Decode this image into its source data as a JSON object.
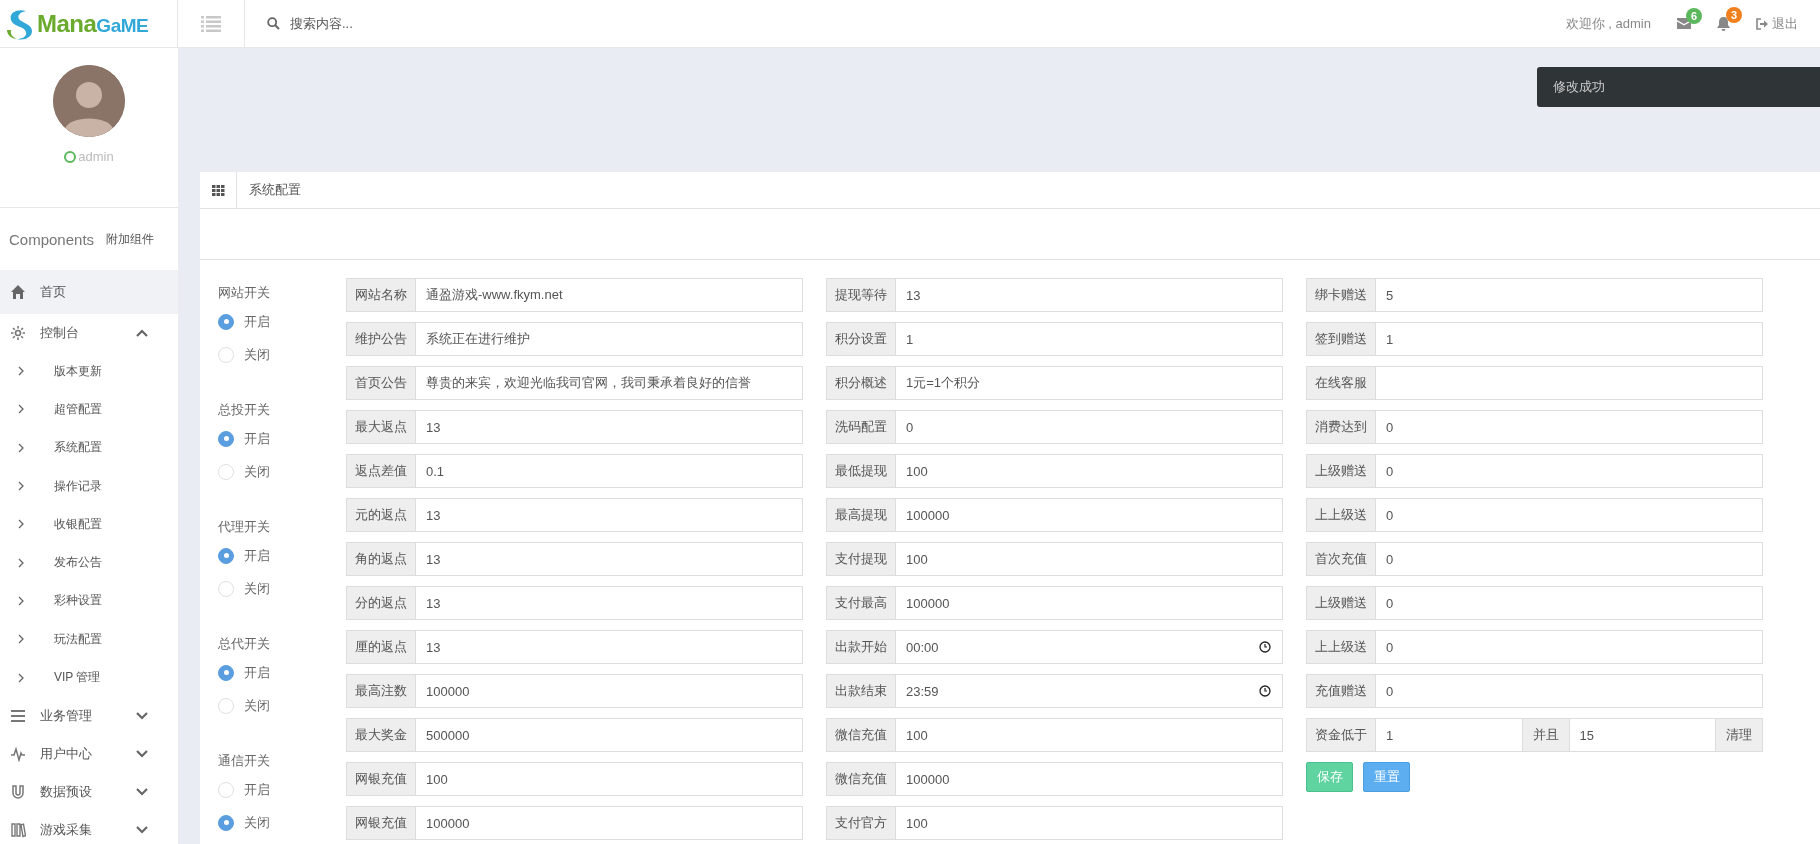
{
  "header": {
    "logo": {
      "first": "Mana",
      "second": "GaME"
    },
    "search": {
      "placeholder": "搜索内容..."
    },
    "welcome": "欢迎你 , admin",
    "messages_badge": "6",
    "alerts_badge": "3",
    "logout": "退出"
  },
  "toast": {
    "message": "修改成功"
  },
  "sidebar": {
    "user": {
      "name": "admin",
      "online": true
    },
    "components": {
      "title": "Components",
      "subtitle": "附加组件"
    },
    "menu": [
      {
        "label": "首页",
        "selected": true
      },
      {
        "label": "控制台",
        "selected": false,
        "expanded": true,
        "children": [
          {
            "label": "版本更新",
            "selected": false
          },
          {
            "label": "超管配置",
            "selected": false
          },
          {
            "label": "系统配置",
            "selected": false
          },
          {
            "label": "操作记录",
            "selected": false
          },
          {
            "label": "收银配置",
            "selected": false
          },
          {
            "label": "发布公告",
            "selected": false
          },
          {
            "label": "彩种设置",
            "selected": false
          },
          {
            "label": "玩法配置",
            "selected": false
          },
          {
            "label": "VIP 管理",
            "selected": false
          }
        ]
      },
      {
        "label": "业务管理",
        "selected": false,
        "expanded": false
      },
      {
        "label": "用户中心",
        "selected": false,
        "expanded": false
      },
      {
        "label": "数据预设",
        "selected": false,
        "expanded": false
      },
      {
        "label": "游戏采集",
        "selected": false,
        "expanded": false
      }
    ]
  },
  "panel": {
    "title": "系统配置"
  },
  "switches": [
    {
      "label": "网站开关",
      "options": [
        {
          "label": "开启",
          "selected": true
        },
        {
          "label": "关闭",
          "selected": false
        }
      ]
    },
    {
      "label": "总投开关",
      "options": [
        {
          "label": "开启",
          "selected": true
        },
        {
          "label": "关闭",
          "selected": false
        }
      ]
    },
    {
      "label": "代理开关",
      "options": [
        {
          "label": "开启",
          "selected": true
        },
        {
          "label": "关闭",
          "selected": false
        }
      ]
    },
    {
      "label": "总代开关",
      "options": [
        {
          "label": "开启",
          "selected": true
        },
        {
          "label": "关闭",
          "selected": false
        }
      ]
    },
    {
      "label": "通信开关",
      "options": [
        {
          "label": "开启",
          "selected": false
        },
        {
          "label": "关闭",
          "selected": true
        }
      ]
    }
  ],
  "columns": [
    [
      {
        "kind": "text",
        "label": "网站名称",
        "value": "通盈游戏-www.fkym.net"
      },
      {
        "kind": "text",
        "label": "维护公告",
        "value": "系统正在进行维护"
      },
      {
        "kind": "text",
        "label": "首页公告",
        "value": "尊贵的来宾，欢迎光临我司官网，我司秉承着良好的信誉"
      },
      {
        "kind": "text",
        "label": "最大返点",
        "value": "13"
      },
      {
        "kind": "text",
        "label": "返点差值",
        "value": "0.1"
      },
      {
        "kind": "text",
        "label": "元的返点",
        "value": "13"
      },
      {
        "kind": "text",
        "label": "角的返点",
        "value": "13"
      },
      {
        "kind": "text",
        "label": "分的返点",
        "value": "13"
      },
      {
        "kind": "text",
        "label": "厘的返点",
        "value": "13"
      },
      {
        "kind": "text",
        "label": "最高注数",
        "value": "100000"
      },
      {
        "kind": "text",
        "label": "最大奖金",
        "value": "500000"
      },
      {
        "kind": "text",
        "label": "网银充值",
        "value": "100"
      },
      {
        "kind": "text",
        "label": "网银充值",
        "value": "100000"
      }
    ],
    [
      {
        "kind": "text",
        "label": "提现等待",
        "value": "13"
      },
      {
        "kind": "text",
        "label": "积分设置",
        "value": "1"
      },
      {
        "kind": "text",
        "label": "积分概述",
        "value": "1元=1个积分"
      },
      {
        "kind": "text",
        "label": "洗码配置",
        "value": "0"
      },
      {
        "kind": "text",
        "label": "最低提现",
        "value": "100"
      },
      {
        "kind": "text",
        "label": "最高提现",
        "value": "100000"
      },
      {
        "kind": "text",
        "label": "支付提现",
        "value": "100"
      },
      {
        "kind": "text",
        "label": "支付最高",
        "value": "100000"
      },
      {
        "kind": "time",
        "label": "出款开始",
        "value": "00:00"
      },
      {
        "kind": "time",
        "label": "出款结束",
        "value": "23:59"
      },
      {
        "kind": "text",
        "label": "微信充值",
        "value": "100"
      },
      {
        "kind": "text",
        "label": "微信充值",
        "value": "100000"
      },
      {
        "kind": "text",
        "label": "支付官方",
        "value": "100"
      }
    ],
    [
      {
        "kind": "text",
        "label": "绑卡赠送",
        "value": "5"
      },
      {
        "kind": "text",
        "label": "签到赠送",
        "value": "1"
      },
      {
        "kind": "text",
        "label": "在线客服"
      },
      {
        "kind": "text",
        "label": "消费达到",
        "value": "0"
      },
      {
        "kind": "text",
        "label": "上级赠送",
        "value": "0"
      },
      {
        "kind": "text",
        "label": "上上级送",
        "value": "0"
      },
      {
        "kind": "text",
        "label": "首次充值",
        "value": "0"
      },
      {
        "kind": "text",
        "label": "上级赠送",
        "value": "0"
      },
      {
        "kind": "text",
        "label": "上上级送",
        "value": "0"
      },
      {
        "kind": "text",
        "label": "充值赠送",
        "value": "0"
      },
      {
        "kind": "range",
        "label": "资金低于",
        "value": "1",
        "joiner": "并且",
        "value2": "15",
        "action": "清理"
      },
      {
        "kind": "buttons",
        "buttons": [
          {
            "kind": "save",
            "label": "保存"
          },
          {
            "kind": "reset",
            "label": "重置"
          }
        ]
      }
    ]
  ]
}
